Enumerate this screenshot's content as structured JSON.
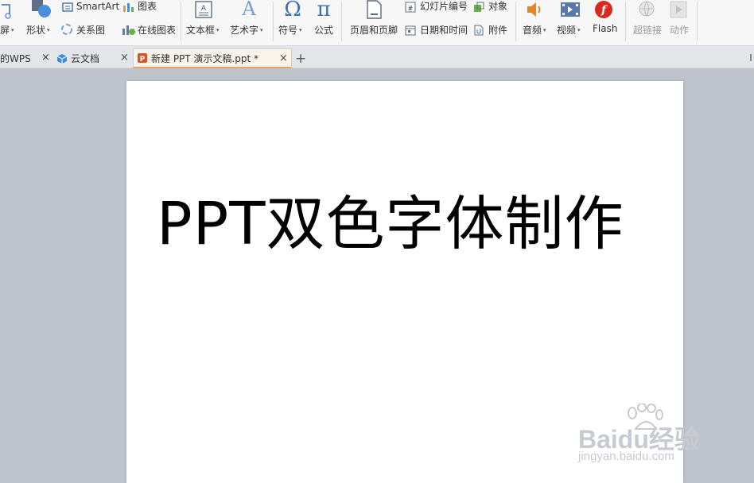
{
  "ribbon": {
    "screen_label": "屏",
    "shape_label": "形状",
    "smartart_label": "SmartArt",
    "relation_label": "关系图",
    "chart_label": "图表",
    "online_chart_label": "在线图表",
    "textbox_label": "文本框",
    "wordart_label": "艺术字",
    "symbol_label": "符号",
    "formula_label": "公式",
    "header_footer_label": "页眉和页脚",
    "slide_number_label": "幻灯片编号",
    "datetime_label": "日期和时间",
    "object_label": "对象",
    "attachment_label": "附件",
    "audio_label": "音频",
    "video_label": "视频",
    "flash_label": "Flash",
    "hyperlink_label": "超链接",
    "action_label": "动作"
  },
  "tabs": [
    {
      "label": "的WPS"
    },
    {
      "label": "云文档"
    },
    {
      "label": "新建 PPT 演示文稿.ppt *"
    }
  ],
  "new_tab_symbol": "+",
  "close_symbol": "×",
  "slide": {
    "title": "PPT双色字体制作"
  },
  "watermark": {
    "brand": "Baidu经验",
    "url": "jingyan.baidu.com"
  },
  "colors": {
    "flash_red": "#d9281c",
    "icon_blue": "#3b6fb6",
    "active_tab_underline": "#e8a45c"
  }
}
